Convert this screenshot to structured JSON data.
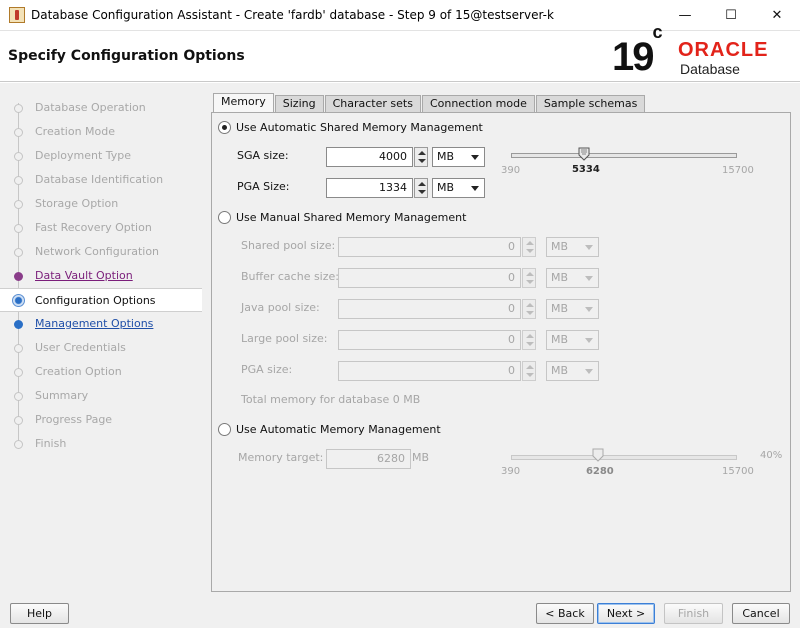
{
  "window": {
    "title": "Database Configuration Assistant - Create 'fardb' database - Step 9 of 15@testserver-k",
    "min_glyph": "—",
    "max_glyph": "☐",
    "close_glyph": "✕"
  },
  "header": {
    "page_title": "Specify Configuration Options",
    "logo": {
      "version": "19",
      "version_sup": "c",
      "brand": "ORACLE",
      "product": "Database"
    }
  },
  "nav": {
    "items": [
      {
        "label": "Database Operation",
        "state": "disabled"
      },
      {
        "label": "Creation Mode",
        "state": "disabled"
      },
      {
        "label": "Deployment Type",
        "state": "disabled"
      },
      {
        "label": "Database Identification",
        "state": "disabled"
      },
      {
        "label": "Storage Option",
        "state": "disabled"
      },
      {
        "label": "Fast Recovery Option",
        "state": "disabled"
      },
      {
        "label": "Network Configuration",
        "state": "disabled"
      },
      {
        "label": "Data Vault Option",
        "state": "visited"
      },
      {
        "label": "Configuration Options",
        "state": "current"
      },
      {
        "label": "Management Options",
        "state": "next"
      },
      {
        "label": "User Credentials",
        "state": "disabled"
      },
      {
        "label": "Creation Option",
        "state": "disabled"
      },
      {
        "label": "Summary",
        "state": "disabled"
      },
      {
        "label": "Progress Page",
        "state": "disabled"
      },
      {
        "label": "Finish",
        "state": "disabled"
      }
    ]
  },
  "tabs": [
    "Memory",
    "Sizing",
    "Character sets",
    "Connection mode",
    "Sample schemas"
  ],
  "memory": {
    "asmm": {
      "label": "Use Automatic Shared Memory Management",
      "selected": true,
      "sga_label": "SGA size:",
      "sga_value": "4000",
      "sga_unit": "MB",
      "pga_label": "PGA Size:",
      "pga_value": "1334",
      "pga_unit": "MB",
      "slider": {
        "min": "390",
        "max": "15700",
        "current": "5334",
        "value": 5334,
        "range": [
          390,
          15700
        ]
      }
    },
    "manual": {
      "label": "Use Manual Shared Memory Management",
      "selected": false,
      "fields": [
        {
          "label": "Shared pool size:",
          "value": "0",
          "unit": "MB"
        },
        {
          "label": "Buffer cache size:",
          "value": "0",
          "unit": "MB"
        },
        {
          "label": "Java pool size:",
          "value": "0",
          "unit": "MB"
        },
        {
          "label": "Large pool size:",
          "value": "0",
          "unit": "MB"
        },
        {
          "label": "PGA size:",
          "value": "0",
          "unit": "MB"
        }
      ],
      "total_text": "Total memory for database 0 MB"
    },
    "amm": {
      "label": "Use Automatic Memory Management",
      "selected": false,
      "target_label": "Memory target:",
      "target_value": "6280",
      "target_unit": "MB",
      "slider": {
        "min": "390",
        "max": "15700",
        "current": "6280",
        "percent": "40%",
        "value": 6280,
        "range": [
          390,
          15700
        ]
      }
    }
  },
  "footer": {
    "help": "Help",
    "back": "< Back",
    "next": "Next >",
    "finish": "Finish",
    "cancel": "Cancel"
  }
}
